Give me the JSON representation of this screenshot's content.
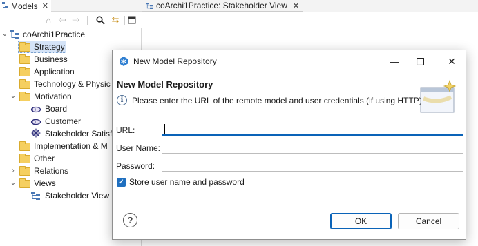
{
  "models_panel": {
    "tab_label": "Models",
    "tree": [
      {
        "label": "coArchi1Practice",
        "kind": "model",
        "expanded": true
      },
      {
        "label": "Strategy",
        "kind": "folder",
        "selected": true
      },
      {
        "label": "Business",
        "kind": "folder"
      },
      {
        "label": "Application",
        "kind": "folder"
      },
      {
        "label": "Technology & Physic",
        "kind": "folder"
      },
      {
        "label": "Motivation",
        "kind": "folder",
        "expanded": true
      },
      {
        "label": "Board",
        "kind": "stakeholder"
      },
      {
        "label": "Customer",
        "kind": "stakeholder"
      },
      {
        "label": "Stakeholder Satisfa",
        "kind": "driver"
      },
      {
        "label": "Implementation & M",
        "kind": "folder"
      },
      {
        "label": "Other",
        "kind": "folder"
      },
      {
        "label": "Relations",
        "kind": "folder",
        "collapsed": true
      },
      {
        "label": "Views",
        "kind": "folder",
        "expanded": true
      },
      {
        "label": "Stakeholder View",
        "kind": "view"
      }
    ]
  },
  "editor": {
    "tab_label": "coArchi1Practice: Stakeholder View"
  },
  "dialog": {
    "title": "New Model Repository",
    "heading": "New Model Repository",
    "message": "Please enter the URL of the remote model and user credentials (if using HTTP)",
    "fields": {
      "url_label": "URL:",
      "url_value": "",
      "username_label": "User Name:",
      "username_value": "",
      "password_label": "Password:",
      "password_value": ""
    },
    "store_credentials_label": "Store user name and password",
    "store_credentials_checked": true,
    "ok_label": "OK",
    "cancel_label": "Cancel"
  },
  "colors": {
    "accent": "#0a63b8",
    "folder": "#f5cf60",
    "selection": "#d4e3f7"
  }
}
